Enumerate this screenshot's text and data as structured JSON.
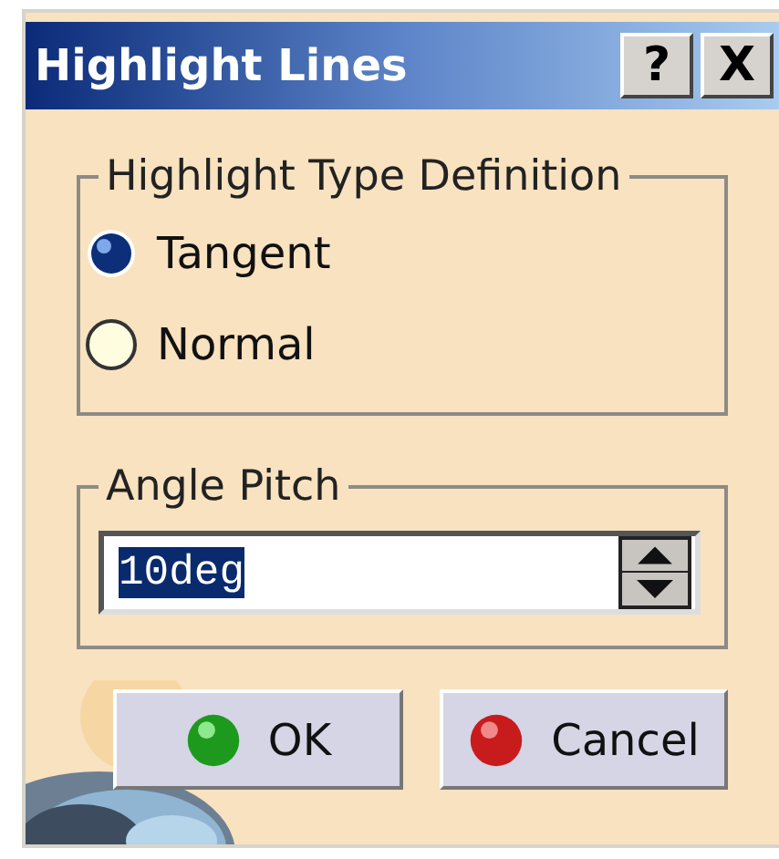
{
  "window": {
    "title": "Highlight Lines",
    "title_buttons": [
      "?",
      "X"
    ]
  },
  "type_group": {
    "legend": "Highlight Type Definition",
    "options": [
      {
        "label": "Tangent",
        "selected": true
      },
      {
        "label": "Normal",
        "selected": false
      }
    ]
  },
  "pitch_group": {
    "legend": "Angle Pitch",
    "field": {
      "value": "10deg",
      "highlighted": true
    }
  },
  "buttons": [
    {
      "label": "OK",
      "kind": "ok"
    },
    {
      "label": "Cancel",
      "kind": "cancel"
    }
  ]
}
